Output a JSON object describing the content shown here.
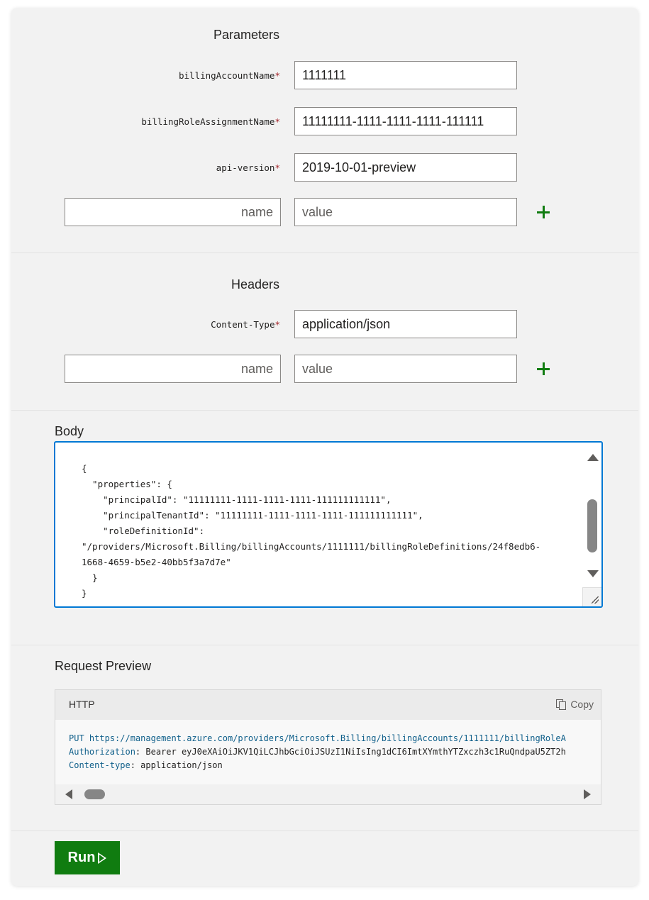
{
  "parameters": {
    "title": "Parameters",
    "rows": [
      {
        "label": "billingAccountName",
        "value": "1111111"
      },
      {
        "label": "billingRoleAssignmentName",
        "value": "11111111-1111-1111-1111-111111"
      },
      {
        "label": "api-version",
        "value": "2019-10-01-preview"
      }
    ],
    "new_name_placeholder": "name",
    "new_value_placeholder": "value"
  },
  "headers": {
    "title": "Headers",
    "rows": [
      {
        "label": "Content-Type",
        "value": "application/json"
      }
    ],
    "new_name_placeholder": "name",
    "new_value_placeholder": "value"
  },
  "required_mark": "*",
  "body": {
    "title": "Body",
    "lines": [
      "{",
      "  \"properties\": {",
      "    \"principalId\": \"11111111-1111-1111-1111-111111111111\",",
      "    \"principalTenantId\": \"11111111-1111-1111-1111-111111111111\",",
      "    \"roleDefinitionId\":",
      "\"/providers/Microsoft.Billing/billingAccounts/1111111/billingRoleDefinitions/24f8edb6-",
      "1668-4659-b5e2-40bb5f3a7d7e\"",
      "  }",
      "}"
    ]
  },
  "request_preview": {
    "title": "Request Preview",
    "tab": "HTTP",
    "copy_label": "Copy",
    "method": "PUT",
    "url": "https://management.azure.com/providers/Microsoft.Billing/billingAccounts/1111111/billingRoleA",
    "auth_key": "Authorization",
    "auth_value": ": Bearer eyJ0eXAiOiJKV1QiLCJhbGciOiJSUzI1NiIsIng1dCI6ImtXYmthYTZxczh3c1RuQndpaU5ZT2h",
    "ct_key": "Content-type",
    "ct_value": ": application/json"
  },
  "run_label": "Run"
}
